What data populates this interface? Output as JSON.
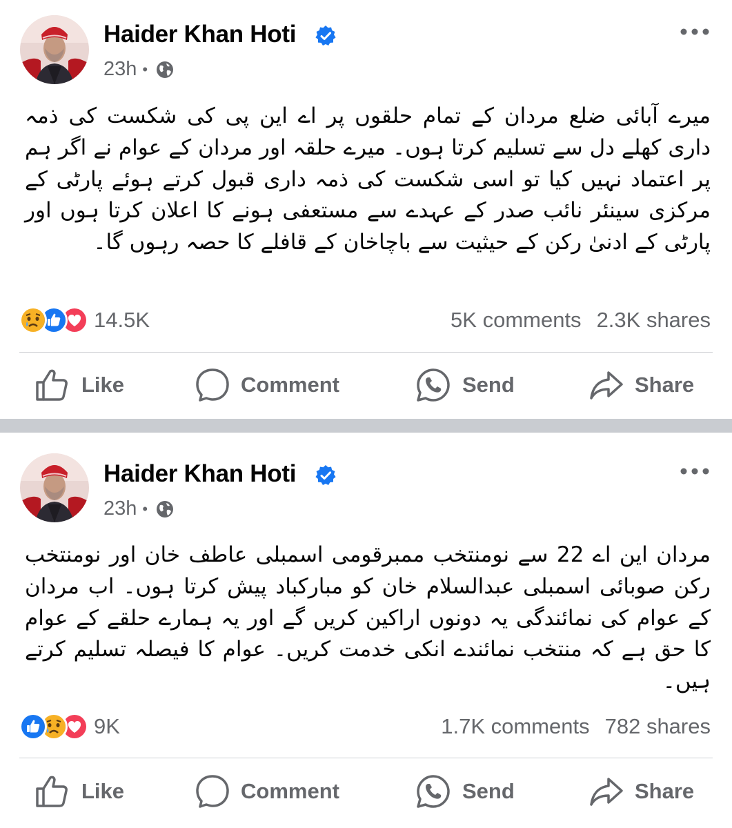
{
  "posts": [
    {
      "author": "Haider Khan Hoti",
      "time": "23h",
      "privacy_icon": "globe-icon",
      "text": "میرے آبائی ضلع مردان کے تمام حلقوں پر اے این پی کی شکست کی ذمہ داری کھلے دل سے تسلیم کرتا ہوں۔ میرے حلقہ اور مردان کے عوام نے اگر ہم پر اعتماد نہیں کیا تو اسی شکست کی ذمہ داری قبول کرتے ہوئے پارٹی کے مرکزی سینئر نائب صدر کے عہدے سے مستعفی ہونے کا اعلان کرتا ہوں اور پارٹی کے ادنیٰ رکن کے حیثیت سے باچاخان کے قافلے کا حصہ رہوں گا۔",
      "reaction_icons": [
        "sad-reaction",
        "like-reaction",
        "love-reaction"
      ],
      "reaction_count": "14.5K",
      "comments": "5K comments",
      "shares": "2.3K shares"
    },
    {
      "author": "Haider Khan Hoti",
      "time": "23h",
      "privacy_icon": "globe-icon",
      "text": "مردان این اے 22 سے نومنتخب ممبرقومی اسمبلی عاطف خان اور نومنتخب رکن صوبائی اسمبلی عبدالسلام خان کو مبارکباد پیش کرتا ہوں۔ اب مردان کے عوام کی نمائندگی یہ دونوں اراکین کریں گے اور یہ ہمارے حلقے کے عوام کا حق ہے کہ منتخب نمائندے انکی خدمت کریں۔ عوام کا فیصلہ تسلیم کرتے ہیں۔",
      "reaction_icons": [
        "like-reaction",
        "sad-reaction",
        "love-reaction"
      ],
      "reaction_count": "9K",
      "comments": "1.7K comments",
      "shares": "782 shares"
    }
  ],
  "actions": {
    "like": "Like",
    "comment": "Comment",
    "send": "Send",
    "share": "Share"
  },
  "colors": {
    "like_blue": "#1877f2",
    "love_red": "#f33e58",
    "sad_yellow": "#f7b125",
    "secondary_text": "#65676b",
    "separator": "#c9ccd1"
  }
}
